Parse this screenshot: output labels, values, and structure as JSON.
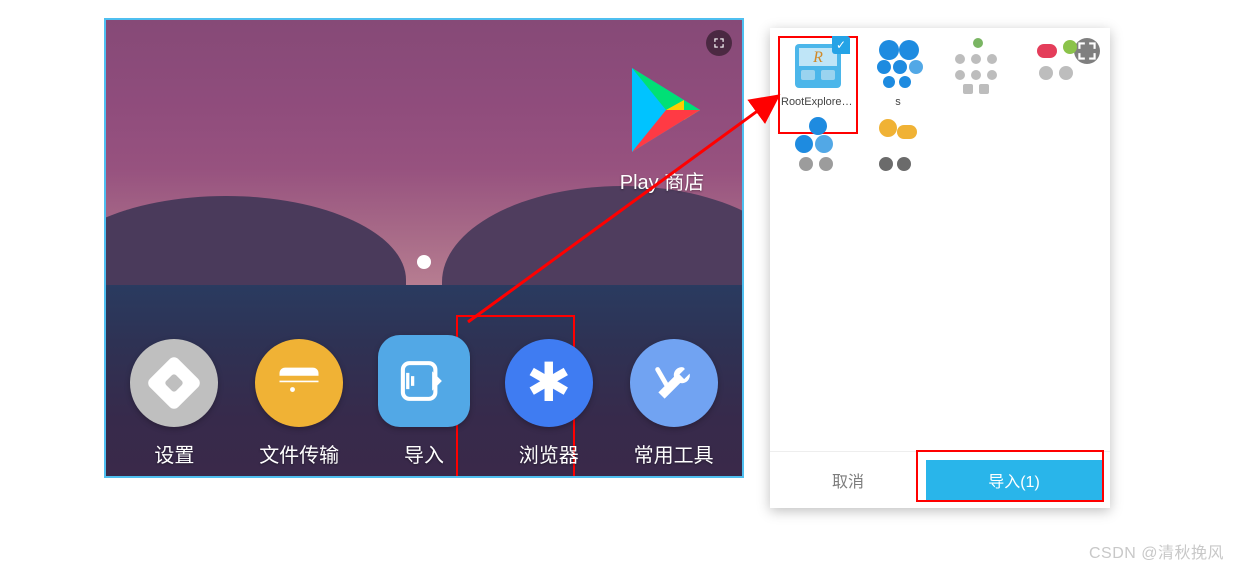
{
  "home": {
    "play_label": "Play 商店",
    "dock": {
      "settings": "设置",
      "filetrans": "文件传输",
      "import": "导入",
      "browser": "浏览器",
      "tools": "常用工具"
    }
  },
  "dialog": {
    "files": {
      "f0": "RootExplorer_117018...",
      "f1": "s",
      "f2": "",
      "f3": "",
      "f4": "",
      "f5": ""
    },
    "cancel": "取消",
    "import_btn": "导入(1)"
  },
  "watermark": "CSDN @清秋挽风"
}
